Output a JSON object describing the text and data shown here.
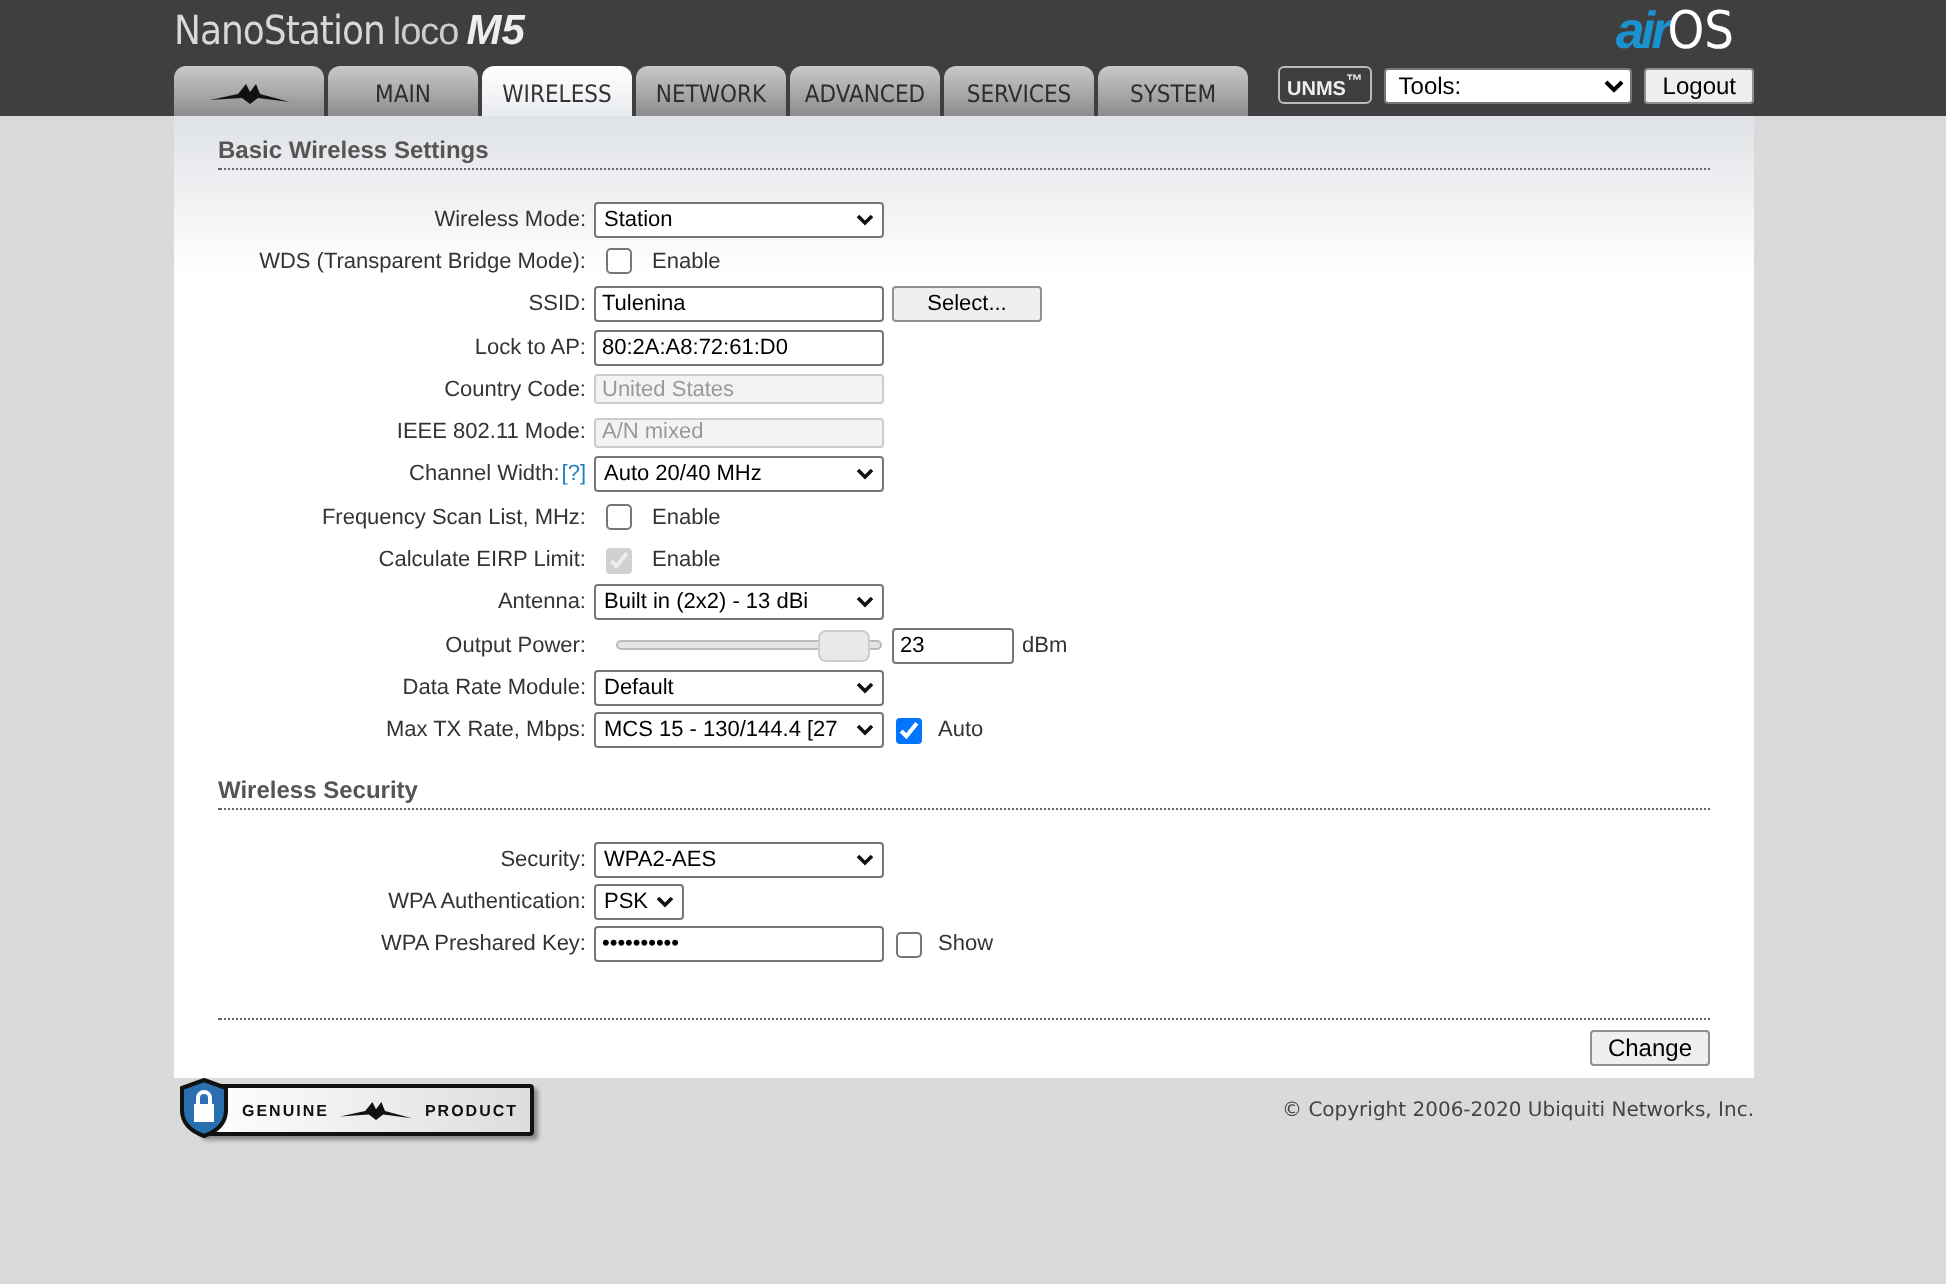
{
  "header": {
    "product_name": "NanoStation",
    "product_variant": "loco",
    "product_model": "M5",
    "os_logo_prefix": "air",
    "os_logo_suffix": "OS"
  },
  "tabs": [
    {
      "kind": "logo",
      "selected": false
    },
    {
      "kind": "text",
      "label": "MAIN",
      "selected": false
    },
    {
      "kind": "text",
      "label": "WIRELESS",
      "selected": true
    },
    {
      "kind": "text",
      "label": "NETWORK",
      "selected": false
    },
    {
      "kind": "text",
      "label": "ADVANCED",
      "selected": false
    },
    {
      "kind": "text",
      "label": "SERVICES",
      "selected": false
    },
    {
      "kind": "text",
      "label": "SYSTEM",
      "selected": false
    }
  ],
  "toolbar": {
    "unms_badge": "UNMS$^{™}$",
    "tools_select": "Tools:",
    "logout_button": "Logout"
  },
  "sections": [
    {
      "title": "Basic Wireless Settings",
      "rows": [
        {
          "kind": "select",
          "label": "Wireless Mode:",
          "value": "Station"
        },
        {
          "kind": "checkbox",
          "label": "WDS (Transparent Bridge Mode):",
          "checked": false,
          "disabled": false,
          "option": "Enable"
        },
        {
          "kind": "text",
          "label": "SSID:",
          "value": "Tulenina",
          "button": "Select..."
        },
        {
          "kind": "text",
          "label": "Lock to AP:",
          "value": "80:2A:A8:72:61:D0"
        },
        {
          "kind": "readonly",
          "label": "Country Code:",
          "value": "United States"
        },
        {
          "kind": "readonly",
          "label": "IEEE 802.11 Mode:",
          "value": "A/N mixed"
        },
        {
          "kind": "select",
          "label": "Channel Width:",
          "help": "[?]",
          "value": "Auto 20/40 MHz"
        },
        {
          "kind": "checkbox",
          "label": "Frequency Scan List, MHz:",
          "checked": false,
          "disabled": false,
          "option": "Enable"
        },
        {
          "kind": "checkbox",
          "label": "Calculate EIRP Limit:",
          "checked": true,
          "disabled": true,
          "option": "Enable"
        },
        {
          "kind": "select",
          "label": "Antenna:",
          "value": "Built in (2x2) - 13 dBi"
        },
        {
          "kind": "slider",
          "label": "Output Power:",
          "level": 0.86,
          "value": "23",
          "unit": "dBm"
        },
        {
          "kind": "select",
          "label": "Data Rate Module:",
          "value": "Default"
        },
        {
          "kind": "select",
          "label": "Max TX Rate, Mbps:",
          "value": "MCS 15 - 130/144.4 [27",
          "extra_checkbox": {
            "checked": true,
            "option": "Auto"
          }
        }
      ]
    },
    {
      "title": "Wireless Security",
      "rows": [
        {
          "kind": "select",
          "label": "Security:",
          "value": "WPA2-AES"
        },
        {
          "kind": "short_select",
          "label": "WPA Authentication:",
          "value": "PSK"
        },
        {
          "kind": "password",
          "label": "WPA Preshared Key:",
          "value": "••••••••••",
          "extra_checkbox": {
            "checked": false,
            "option": "Show"
          }
        }
      ]
    }
  ],
  "change_button": "Change",
  "footer": {
    "badge_left": "GENUINE",
    "badge_right": "PRODUCT",
    "copyright": "© Copyright 2006-2020 Ubiquiti Networks, Inc."
  }
}
